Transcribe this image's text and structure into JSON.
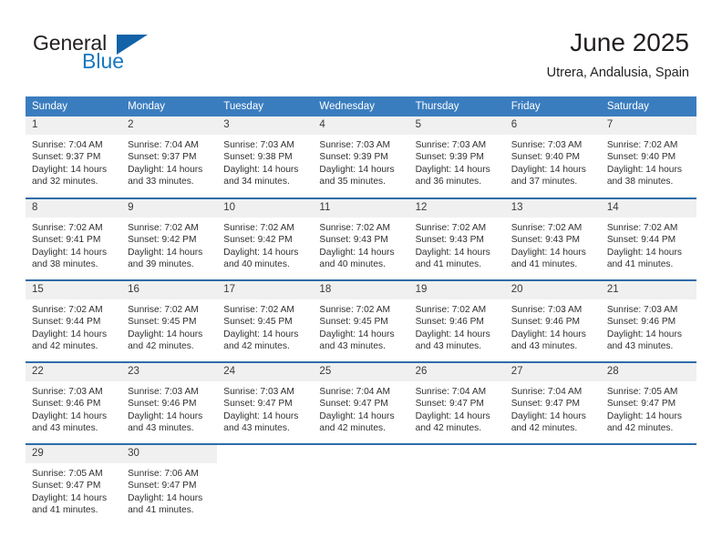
{
  "brand": {
    "word1": "General",
    "word2": "Blue",
    "accent_color": "#1262a8"
  },
  "header": {
    "title": "June 2025",
    "location": "Utrera, Andalusia, Spain"
  },
  "calendar": {
    "header_bg": "#3a7dbf",
    "row_rule_color": "#2f6da8",
    "daynum_bg": "#f0f0f0",
    "weekdays": [
      "Sunday",
      "Monday",
      "Tuesday",
      "Wednesday",
      "Thursday",
      "Friday",
      "Saturday"
    ],
    "weeks": [
      [
        {
          "day": "1",
          "sunrise": "Sunrise: 7:04 AM",
          "sunset": "Sunset: 9:37 PM",
          "daylight1": "Daylight: 14 hours",
          "daylight2": "and 32 minutes."
        },
        {
          "day": "2",
          "sunrise": "Sunrise: 7:04 AM",
          "sunset": "Sunset: 9:37 PM",
          "daylight1": "Daylight: 14 hours",
          "daylight2": "and 33 minutes."
        },
        {
          "day": "3",
          "sunrise": "Sunrise: 7:03 AM",
          "sunset": "Sunset: 9:38 PM",
          "daylight1": "Daylight: 14 hours",
          "daylight2": "and 34 minutes."
        },
        {
          "day": "4",
          "sunrise": "Sunrise: 7:03 AM",
          "sunset": "Sunset: 9:39 PM",
          "daylight1": "Daylight: 14 hours",
          "daylight2": "and 35 minutes."
        },
        {
          "day": "5",
          "sunrise": "Sunrise: 7:03 AM",
          "sunset": "Sunset: 9:39 PM",
          "daylight1": "Daylight: 14 hours",
          "daylight2": "and 36 minutes."
        },
        {
          "day": "6",
          "sunrise": "Sunrise: 7:03 AM",
          "sunset": "Sunset: 9:40 PM",
          "daylight1": "Daylight: 14 hours",
          "daylight2": "and 37 minutes."
        },
        {
          "day": "7",
          "sunrise": "Sunrise: 7:02 AM",
          "sunset": "Sunset: 9:40 PM",
          "daylight1": "Daylight: 14 hours",
          "daylight2": "and 38 minutes."
        }
      ],
      [
        {
          "day": "8",
          "sunrise": "Sunrise: 7:02 AM",
          "sunset": "Sunset: 9:41 PM",
          "daylight1": "Daylight: 14 hours",
          "daylight2": "and 38 minutes."
        },
        {
          "day": "9",
          "sunrise": "Sunrise: 7:02 AM",
          "sunset": "Sunset: 9:42 PM",
          "daylight1": "Daylight: 14 hours",
          "daylight2": "and 39 minutes."
        },
        {
          "day": "10",
          "sunrise": "Sunrise: 7:02 AM",
          "sunset": "Sunset: 9:42 PM",
          "daylight1": "Daylight: 14 hours",
          "daylight2": "and 40 minutes."
        },
        {
          "day": "11",
          "sunrise": "Sunrise: 7:02 AM",
          "sunset": "Sunset: 9:43 PM",
          "daylight1": "Daylight: 14 hours",
          "daylight2": "and 40 minutes."
        },
        {
          "day": "12",
          "sunrise": "Sunrise: 7:02 AM",
          "sunset": "Sunset: 9:43 PM",
          "daylight1": "Daylight: 14 hours",
          "daylight2": "and 41 minutes."
        },
        {
          "day": "13",
          "sunrise": "Sunrise: 7:02 AM",
          "sunset": "Sunset: 9:43 PM",
          "daylight1": "Daylight: 14 hours",
          "daylight2": "and 41 minutes."
        },
        {
          "day": "14",
          "sunrise": "Sunrise: 7:02 AM",
          "sunset": "Sunset: 9:44 PM",
          "daylight1": "Daylight: 14 hours",
          "daylight2": "and 41 minutes."
        }
      ],
      [
        {
          "day": "15",
          "sunrise": "Sunrise: 7:02 AM",
          "sunset": "Sunset: 9:44 PM",
          "daylight1": "Daylight: 14 hours",
          "daylight2": "and 42 minutes."
        },
        {
          "day": "16",
          "sunrise": "Sunrise: 7:02 AM",
          "sunset": "Sunset: 9:45 PM",
          "daylight1": "Daylight: 14 hours",
          "daylight2": "and 42 minutes."
        },
        {
          "day": "17",
          "sunrise": "Sunrise: 7:02 AM",
          "sunset": "Sunset: 9:45 PM",
          "daylight1": "Daylight: 14 hours",
          "daylight2": "and 42 minutes."
        },
        {
          "day": "18",
          "sunrise": "Sunrise: 7:02 AM",
          "sunset": "Sunset: 9:45 PM",
          "daylight1": "Daylight: 14 hours",
          "daylight2": "and 43 minutes."
        },
        {
          "day": "19",
          "sunrise": "Sunrise: 7:02 AM",
          "sunset": "Sunset: 9:46 PM",
          "daylight1": "Daylight: 14 hours",
          "daylight2": "and 43 minutes."
        },
        {
          "day": "20",
          "sunrise": "Sunrise: 7:03 AM",
          "sunset": "Sunset: 9:46 PM",
          "daylight1": "Daylight: 14 hours",
          "daylight2": "and 43 minutes."
        },
        {
          "day": "21",
          "sunrise": "Sunrise: 7:03 AM",
          "sunset": "Sunset: 9:46 PM",
          "daylight1": "Daylight: 14 hours",
          "daylight2": "and 43 minutes."
        }
      ],
      [
        {
          "day": "22",
          "sunrise": "Sunrise: 7:03 AM",
          "sunset": "Sunset: 9:46 PM",
          "daylight1": "Daylight: 14 hours",
          "daylight2": "and 43 minutes."
        },
        {
          "day": "23",
          "sunrise": "Sunrise: 7:03 AM",
          "sunset": "Sunset: 9:46 PM",
          "daylight1": "Daylight: 14 hours",
          "daylight2": "and 43 minutes."
        },
        {
          "day": "24",
          "sunrise": "Sunrise: 7:03 AM",
          "sunset": "Sunset: 9:47 PM",
          "daylight1": "Daylight: 14 hours",
          "daylight2": "and 43 minutes."
        },
        {
          "day": "25",
          "sunrise": "Sunrise: 7:04 AM",
          "sunset": "Sunset: 9:47 PM",
          "daylight1": "Daylight: 14 hours",
          "daylight2": "and 42 minutes."
        },
        {
          "day": "26",
          "sunrise": "Sunrise: 7:04 AM",
          "sunset": "Sunset: 9:47 PM",
          "daylight1": "Daylight: 14 hours",
          "daylight2": "and 42 minutes."
        },
        {
          "day": "27",
          "sunrise": "Sunrise: 7:04 AM",
          "sunset": "Sunset: 9:47 PM",
          "daylight1": "Daylight: 14 hours",
          "daylight2": "and 42 minutes."
        },
        {
          "day": "28",
          "sunrise": "Sunrise: 7:05 AM",
          "sunset": "Sunset: 9:47 PM",
          "daylight1": "Daylight: 14 hours",
          "daylight2": "and 42 minutes."
        }
      ],
      [
        {
          "day": "29",
          "sunrise": "Sunrise: 7:05 AM",
          "sunset": "Sunset: 9:47 PM",
          "daylight1": "Daylight: 14 hours",
          "daylight2": "and 41 minutes."
        },
        {
          "day": "30",
          "sunrise": "Sunrise: 7:06 AM",
          "sunset": "Sunset: 9:47 PM",
          "daylight1": "Daylight: 14 hours",
          "daylight2": "and 41 minutes."
        },
        {
          "day": "",
          "sunrise": "",
          "sunset": "",
          "daylight1": "",
          "daylight2": ""
        },
        {
          "day": "",
          "sunrise": "",
          "sunset": "",
          "daylight1": "",
          "daylight2": ""
        },
        {
          "day": "",
          "sunrise": "",
          "sunset": "",
          "daylight1": "",
          "daylight2": ""
        },
        {
          "day": "",
          "sunrise": "",
          "sunset": "",
          "daylight1": "",
          "daylight2": ""
        },
        {
          "day": "",
          "sunrise": "",
          "sunset": "",
          "daylight1": "",
          "daylight2": ""
        }
      ]
    ]
  }
}
